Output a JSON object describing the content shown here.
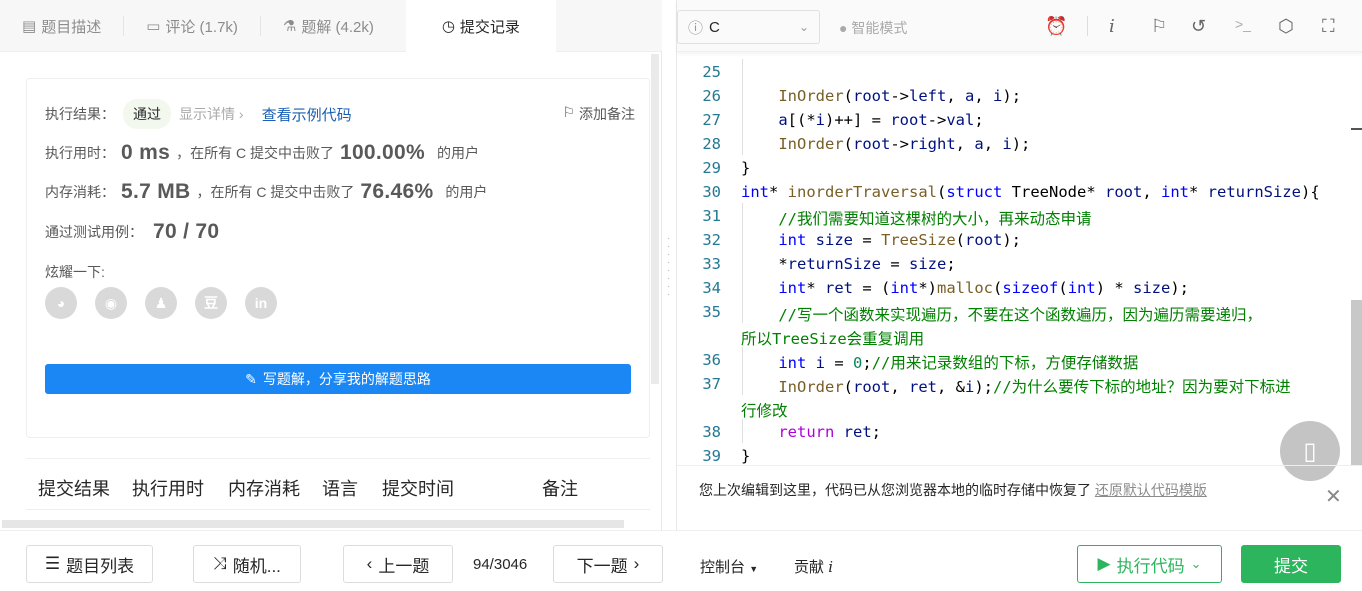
{
  "tabs": [
    {
      "label": "题目描述",
      "icon": "description-icon"
    },
    {
      "label": "评论 (1.7k)",
      "icon": "comment-icon"
    },
    {
      "label": "题解 (4.2k)",
      "icon": "flask-icon"
    },
    {
      "label": "提交记录",
      "icon": "clock-icon",
      "active": true
    }
  ],
  "result": {
    "result_label": "执行结果：",
    "status": "通过",
    "details": "显示详情 ›",
    "sample_code": "查看示例代码",
    "add_note": "添加备注",
    "time_label": "执行用时：",
    "time_value": "0 ms",
    "beat_text": "，在所有 C 提交中击败了",
    "time_pct": "100.00%",
    "users": "的用户",
    "mem_label": "内存消耗：",
    "mem_value": "5.7 MB",
    "mem_pct": "76.46%",
    "tests_label": "通过测试用例：",
    "tests_value": "70 / 70",
    "share_label": "炫耀一下:",
    "share": [
      "wechat",
      "weibo",
      "qq",
      "douban",
      "linkedin"
    ],
    "write_solution": "写题解，分享我的解题思路"
  },
  "table_headers": [
    "提交结果",
    "执行用时",
    "内存消耗",
    "语言",
    "提交时间",
    "备注"
  ],
  "editor": {
    "language": "C",
    "mode": "智能模式",
    "lines": [
      {
        "n": "25",
        "t": []
      },
      {
        "n": "26",
        "t": [
          [
            "    ",
            ""
          ],
          [
            "InOrder",
            "f"
          ],
          [
            "(",
            ""
          ],
          [
            "root",
            "v"
          ],
          [
            "->",
            ""
          ],
          [
            "left",
            "v"
          ],
          [
            ", ",
            ""
          ],
          [
            "a",
            "v"
          ],
          [
            ", ",
            ""
          ],
          [
            "i",
            "v"
          ],
          [
            ");",
            ""
          ]
        ]
      },
      {
        "n": "27",
        "t": [
          [
            "    ",
            ""
          ],
          [
            "a",
            "v"
          ],
          [
            "[(*",
            ""
          ],
          [
            "i",
            "v"
          ],
          [
            ")++] = ",
            ""
          ],
          [
            "root",
            "v"
          ],
          [
            "->",
            ""
          ],
          [
            "val",
            "v"
          ],
          [
            ";",
            ""
          ]
        ]
      },
      {
        "n": "28",
        "t": [
          [
            "    ",
            ""
          ],
          [
            "InOrder",
            "f"
          ],
          [
            "(",
            ""
          ],
          [
            "root",
            "v"
          ],
          [
            "->",
            ""
          ],
          [
            "right",
            "v"
          ],
          [
            ", ",
            ""
          ],
          [
            "a",
            "v"
          ],
          [
            ", ",
            ""
          ],
          [
            "i",
            "v"
          ],
          [
            ");",
            ""
          ]
        ]
      },
      {
        "n": "29",
        "t": [
          [
            "}",
            ""
          ]
        ]
      },
      {
        "n": "30",
        "t": [
          [
            "int",
            "k"
          ],
          [
            "* ",
            ""
          ],
          [
            "inorderTraversal",
            "f"
          ],
          [
            "(",
            ""
          ],
          [
            "struct",
            "k"
          ],
          [
            " TreeNode* ",
            ""
          ],
          [
            "root",
            "v"
          ],
          [
            ", ",
            ""
          ],
          [
            "int",
            "k"
          ],
          [
            "* ",
            ""
          ],
          [
            "returnSize",
            "v"
          ],
          [
            "){",
            ""
          ]
        ]
      },
      {
        "n": "31",
        "t": [
          [
            "    ",
            ""
          ],
          [
            "//我们需要知道这棵树的大小，再来动态申请",
            "c"
          ]
        ]
      },
      {
        "n": "32",
        "t": [
          [
            "    ",
            ""
          ],
          [
            "int",
            "k"
          ],
          [
            " ",
            ""
          ],
          [
            "size",
            "v"
          ],
          [
            " = ",
            ""
          ],
          [
            "TreeSize",
            "f"
          ],
          [
            "(",
            ""
          ],
          [
            "root",
            "v"
          ],
          [
            ");",
            ""
          ]
        ]
      },
      {
        "n": "33",
        "t": [
          [
            "    *",
            ""
          ],
          [
            "returnSize",
            "v"
          ],
          [
            " = ",
            ""
          ],
          [
            "size",
            "v"
          ],
          [
            ";",
            ""
          ]
        ]
      },
      {
        "n": "34",
        "t": [
          [
            "    ",
            ""
          ],
          [
            "int",
            "k"
          ],
          [
            "* ",
            ""
          ],
          [
            "ret",
            "v"
          ],
          [
            " = (",
            ""
          ],
          [
            "int",
            "k"
          ],
          [
            "*)",
            ""
          ],
          [
            "malloc",
            "f"
          ],
          [
            "(",
            ""
          ],
          [
            "sizeof",
            "k"
          ],
          [
            "(",
            ""
          ],
          [
            "int",
            "k"
          ],
          [
            ") * ",
            ""
          ],
          [
            "size",
            "v"
          ],
          [
            ");",
            ""
          ]
        ]
      },
      {
        "n": "35",
        "t": [
          [
            "    ",
            ""
          ],
          [
            "//写一个函数来实现遍历，不要在这个函数遍历，因为遍历需要递归，",
            "c"
          ]
        ]
      },
      {
        "n": "",
        "t": [
          [
            "所以TreeSize会重复调用",
            "c"
          ]
        ]
      },
      {
        "n": "36",
        "t": [
          [
            "    ",
            ""
          ],
          [
            "int",
            "k"
          ],
          [
            " ",
            ""
          ],
          [
            "i",
            "v"
          ],
          [
            " = ",
            ""
          ],
          [
            "0",
            "n"
          ],
          [
            ";",
            ""
          ],
          [
            "//用来记录数组的下标，方便存储数据",
            "c"
          ]
        ]
      },
      {
        "n": "37",
        "t": [
          [
            "    ",
            ""
          ],
          [
            "InOrder",
            "f"
          ],
          [
            "(",
            ""
          ],
          [
            "root",
            "v"
          ],
          [
            ", ",
            ""
          ],
          [
            "ret",
            "v"
          ],
          [
            ", &",
            ""
          ],
          [
            "i",
            "v"
          ],
          [
            ");",
            ""
          ],
          [
            "//为什么要传下标的地址？因为要对下标进",
            "c"
          ]
        ]
      },
      {
        "n": "",
        "t": [
          [
            "行修改",
            "c"
          ]
        ]
      },
      {
        "n": "38",
        "t": [
          [
            "    ",
            ""
          ],
          [
            "return",
            "r"
          ],
          [
            " ",
            ""
          ],
          [
            "ret",
            "v"
          ],
          [
            ";",
            ""
          ]
        ]
      },
      {
        "n": "39",
        "t": [
          [
            "}",
            ""
          ]
        ]
      }
    ],
    "notice": "您上次编辑到这里，代码已从您浏览器本地的临时存储中恢复了",
    "restore_link": "还原默认代码模版"
  },
  "bottom": {
    "problem_list": "题目列表",
    "random": "随机...",
    "prev": "上一题",
    "page": "94/3046",
    "next": "下一题",
    "console": "控制台",
    "contribute": "贡献",
    "run": "执行代码",
    "submit": "提交"
  },
  "colors": {
    "accent_green": "#2db55d",
    "link_blue": "#1a87f4"
  }
}
